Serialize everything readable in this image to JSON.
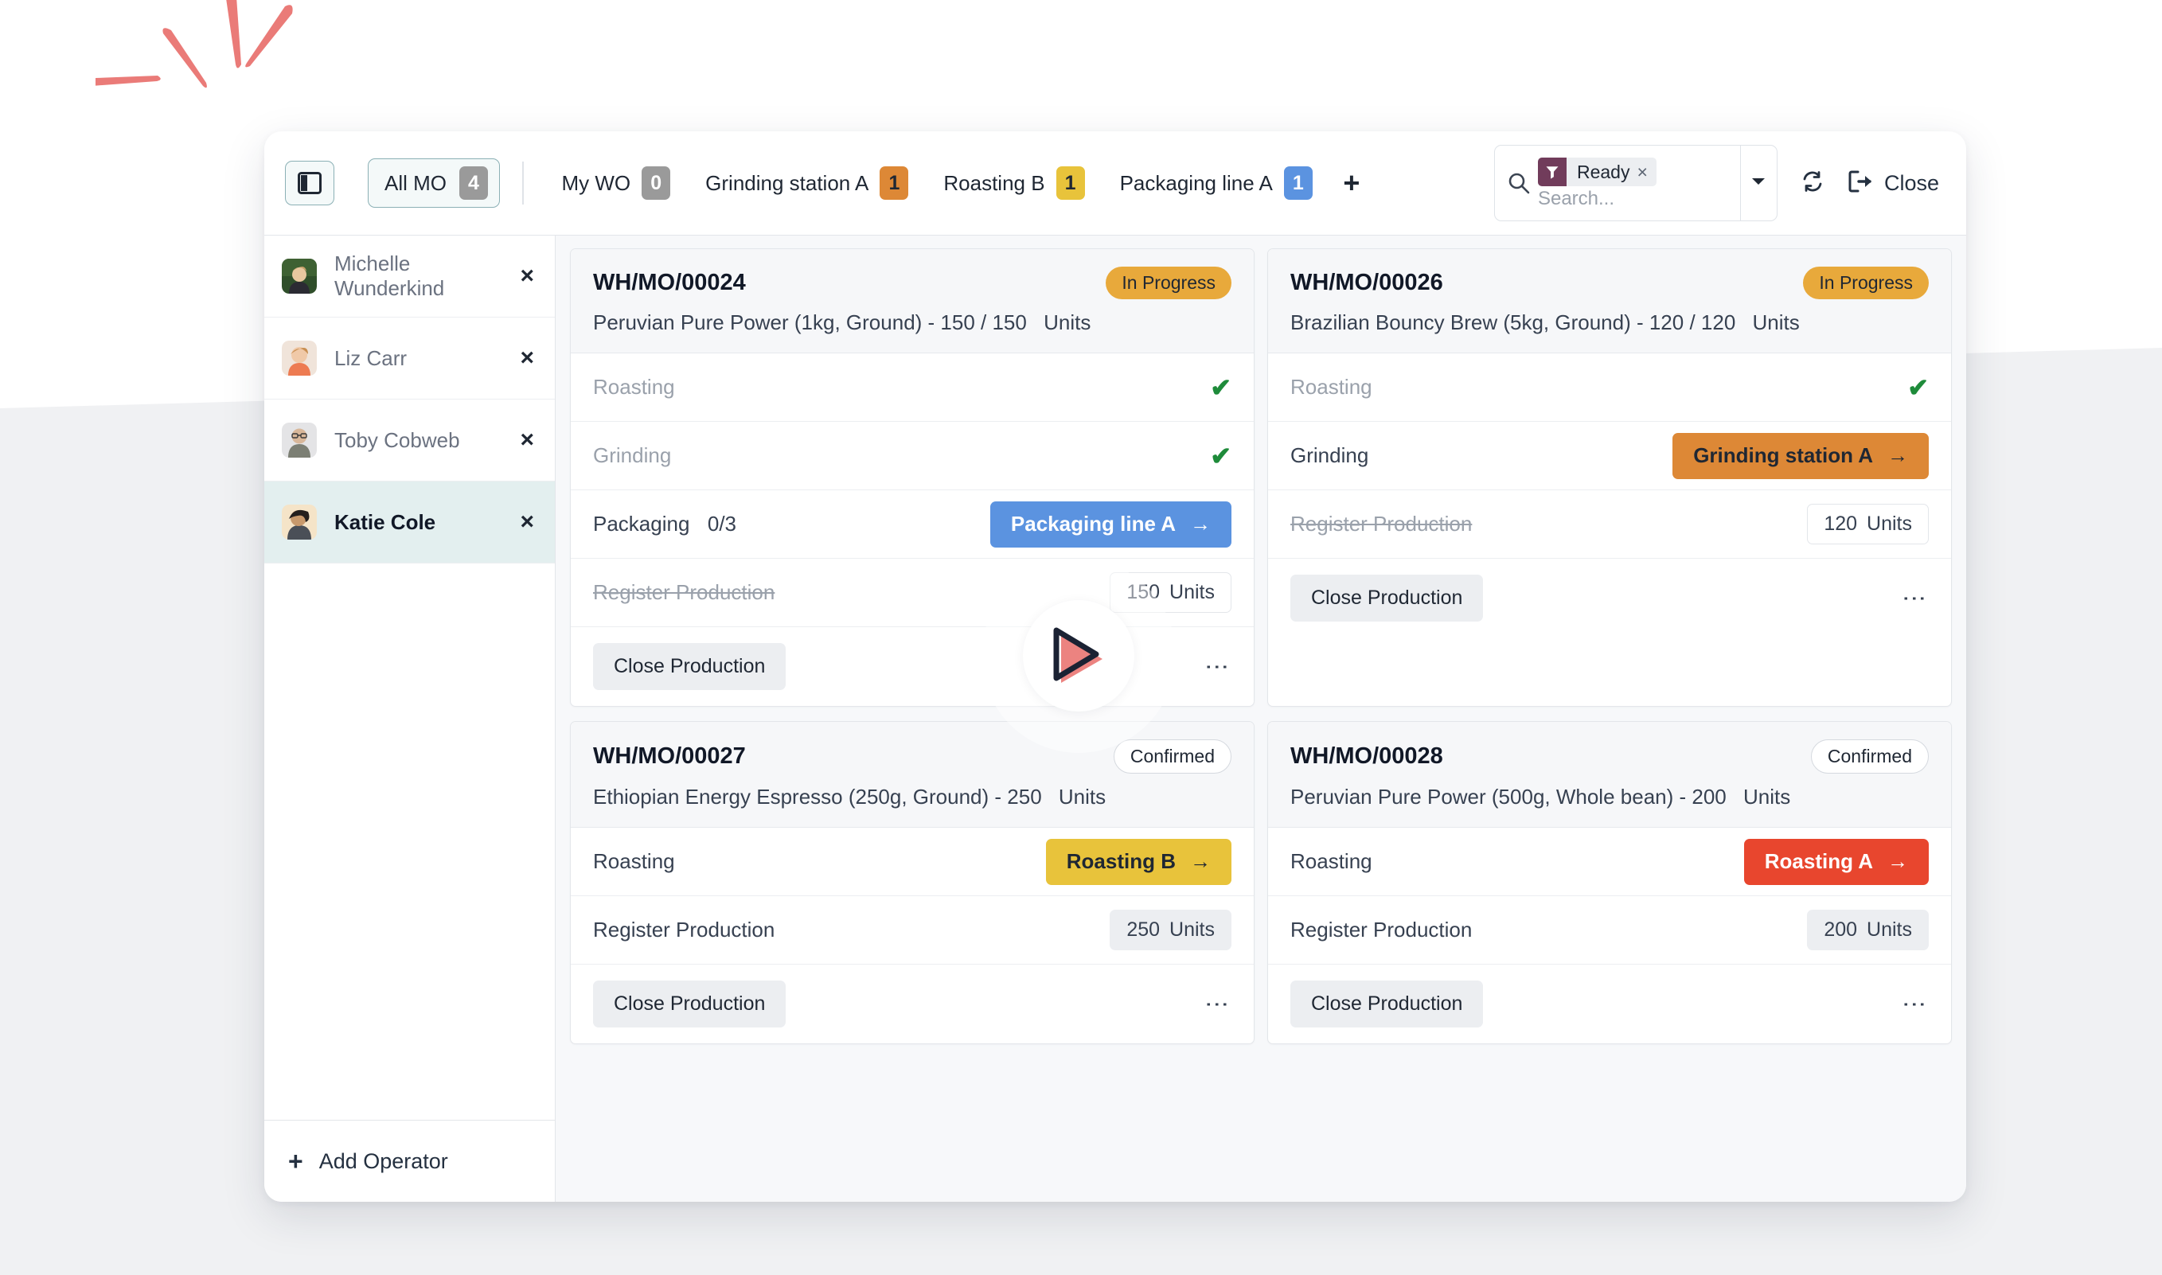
{
  "toolbar": {
    "panel_toggle_icon": "panel-layout-icon",
    "all_mo": {
      "label": "All MO",
      "count": "4"
    },
    "tabs": [
      {
        "label": "My WO",
        "count": "0",
        "badge_color": "gray"
      },
      {
        "label": "Grinding station A",
        "count": "1",
        "badge_color": "orange"
      },
      {
        "label": "Roasting B",
        "count": "1",
        "badge_color": "yellow"
      },
      {
        "label": "Packaging line A",
        "count": "1",
        "badge_color": "blue"
      }
    ],
    "add_tab_label": "+",
    "search": {
      "icon": "search-icon",
      "facet_icon": "filter-funnel-icon",
      "facet_label": "Ready",
      "facet_remove": "×",
      "placeholder": "Search...",
      "caret_icon": "chevron-down-icon"
    },
    "refresh_icon": "refresh-icon",
    "close": {
      "icon": "logout-icon",
      "label": "Close"
    }
  },
  "sidebar": {
    "operators": [
      {
        "name": "Michelle Wunderkind",
        "active": false,
        "remove": "×"
      },
      {
        "name": "Liz Carr",
        "active": false,
        "remove": "×"
      },
      {
        "name": "Toby Cobweb",
        "active": false,
        "remove": "×"
      },
      {
        "name": "Katie Cole",
        "active": true,
        "remove": "×"
      }
    ],
    "add_operator": {
      "plus": "+",
      "label": "Add Operator"
    }
  },
  "cards": [
    {
      "ref": "WH/MO/00024",
      "status": "In Progress",
      "status_style": "inprogress",
      "description": "Peruvian Pure Power (1kg, Ground) - 150 / 150",
      "units_label": "Units",
      "rows": [
        {
          "label": "Roasting",
          "label_style": "muted",
          "right_type": "check"
        },
        {
          "label": "Grinding",
          "label_style": "muted",
          "right_type": "check"
        },
        {
          "label": "Packaging",
          "count": "0/3",
          "label_style": "normal",
          "right_type": "button",
          "button_label": "Packaging line A",
          "button_color": "blue",
          "button_arrow": "→"
        },
        {
          "label": "Register Production",
          "label_style": "struck",
          "right_type": "qty",
          "qty": "150",
          "qty_units": "Units",
          "qty_style": "outline"
        }
      ],
      "footer": {
        "close_label": "Close Production",
        "kebab": "⋮"
      }
    },
    {
      "ref": "WH/MO/00026",
      "status": "In Progress",
      "status_style": "inprogress",
      "description": "Brazilian Bouncy Brew (5kg, Ground) - 120 / 120",
      "units_label": "Units",
      "rows": [
        {
          "label": "Roasting",
          "label_style": "muted",
          "right_type": "check"
        },
        {
          "label": "Grinding",
          "label_style": "normal",
          "right_type": "button",
          "button_label": "Grinding station A",
          "button_color": "orange",
          "button_arrow": "→"
        },
        {
          "label": "Register Production",
          "label_style": "struck",
          "right_type": "qty",
          "qty": "120",
          "qty_units": "Units",
          "qty_style": "outline"
        }
      ],
      "footer": {
        "close_label": "Close Production",
        "kebab": "⋮"
      }
    },
    {
      "ref": "WH/MO/00027",
      "status": "Confirmed",
      "status_style": "confirmed",
      "description": "Ethiopian Energy Espresso (250g, Ground) - 250",
      "units_label": "Units",
      "rows": [
        {
          "label": "Roasting",
          "label_style": "normal",
          "right_type": "button",
          "button_label": "Roasting B",
          "button_color": "yellow",
          "button_arrow": "→"
        },
        {
          "label": "Register Production",
          "label_style": "normal",
          "right_type": "qty",
          "qty": "250",
          "qty_units": "Units",
          "qty_style": "filled"
        }
      ],
      "footer": {
        "close_label": "Close Production",
        "kebab": "⋮"
      }
    },
    {
      "ref": "WH/MO/00028",
      "status": "Confirmed",
      "status_style": "confirmed",
      "description": "Peruvian Pure Power (500g, Whole bean) - 200",
      "units_label": "Units",
      "rows": [
        {
          "label": "Roasting",
          "label_style": "normal",
          "right_type": "button",
          "button_label": "Roasting A",
          "button_color": "red",
          "button_arrow": "→"
        },
        {
          "label": "Register Production",
          "label_style": "normal",
          "right_type": "qty",
          "qty": "200",
          "qty_units": "Units",
          "qty_style": "filled"
        }
      ],
      "footer": {
        "close_label": "Close Production",
        "kebab": "⋮"
      }
    }
  ],
  "overlay": {
    "play_icon": "play-button-icon"
  },
  "colors": {
    "accent_teal": "#8bb0b5",
    "orange": "#dd8836",
    "yellow": "#e8c33b",
    "blue": "#5b93e0",
    "red": "#e8462e",
    "green_check": "#1e8b3a",
    "status_amber": "#e8a93b",
    "facet_purple": "#713c5b",
    "burst_red": "#ea7b78"
  }
}
